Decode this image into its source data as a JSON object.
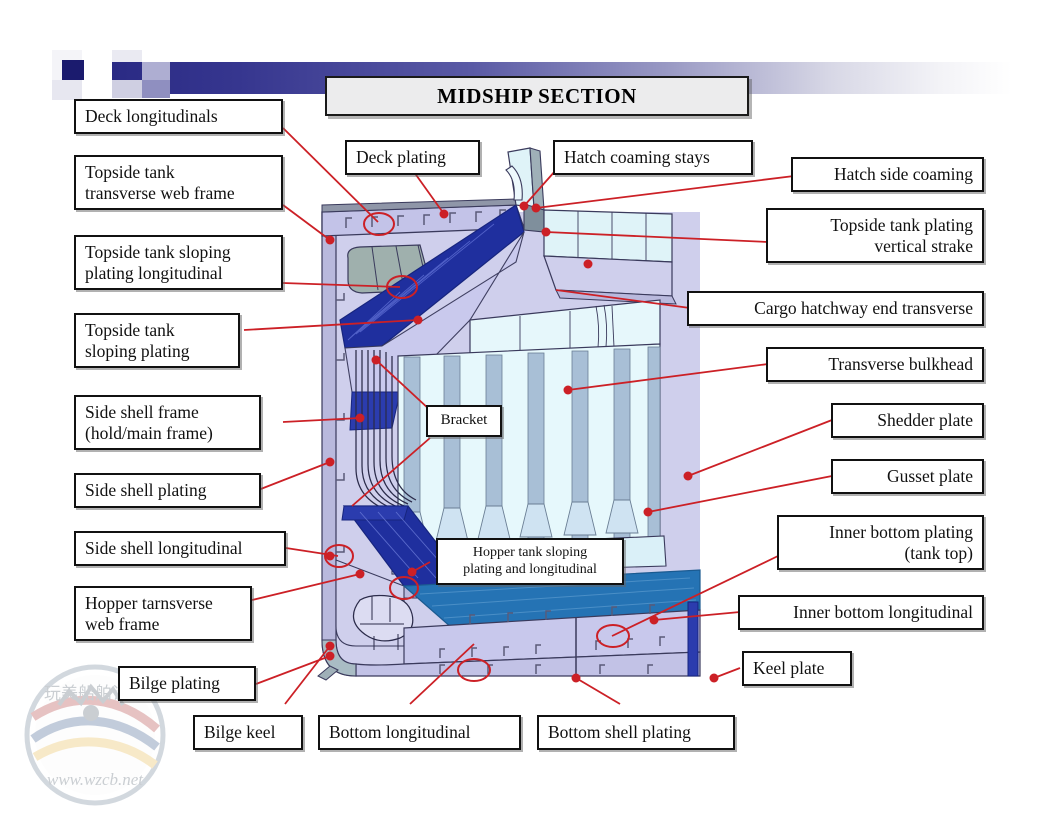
{
  "title": "MIDSHIP SECTION",
  "diagram_name": "ship-midship-section-drawing",
  "watermark": {
    "text_cn": "玩美船舶论坛",
    "url": "www.wzcb.net"
  },
  "colors": {
    "leader_line": "#cc2026",
    "dark_blue_plating": "#1f2f9e",
    "inner_bottom_blue": "#2573b4",
    "lavender_shell": "#c7c7ef",
    "pale_cyan_bulkhead": "#e2f6fb",
    "stiffener_blue_grey": "#a8bfd6",
    "outline": "#2b2b4a",
    "title_fill": "#ececed",
    "band_start": "#2a2a84"
  },
  "labels": {
    "left": [
      {
        "id": "deck-longitudinals",
        "text": "Deck longitudinals"
      },
      {
        "id": "topside-tank-transverse-web-frame",
        "line1": "Topside tank",
        "line2": "transverse web frame"
      },
      {
        "id": "topside-tank-sloping-plating-longitudinal",
        "line1": "Topside tank sloping",
        "line2": "plating longitudinal"
      },
      {
        "id": "topside-tank-sloping-plating",
        "line1": "Topside tank",
        "line2": "sloping plating"
      },
      {
        "id": "side-shell-frame",
        "line1": "Side shell frame",
        "line2": "(hold/main frame)"
      },
      {
        "id": "side-shell-plating",
        "text": "Side shell plating"
      },
      {
        "id": "side-shell-longitudinal",
        "text": "Side shell longitudinal"
      },
      {
        "id": "hopper-transverse-web-frame",
        "line1": "Hopper tarnsverse",
        "line2": "web frame"
      },
      {
        "id": "bilge-plating",
        "text": "Bilge plating"
      }
    ],
    "top": [
      {
        "id": "deck-plating",
        "text": "Deck plating"
      },
      {
        "id": "hatch-coaming-stays",
        "text": "Hatch coaming stays"
      }
    ],
    "right": [
      {
        "id": "hatch-side-coaming",
        "text": "Hatch side coaming"
      },
      {
        "id": "topside-tank-plating-vertical-strake",
        "line1": "Topside tank plating",
        "line2": "vertical strake"
      },
      {
        "id": "cargo-hatchway-end-transverse",
        "text": "Cargo hatchway end transverse"
      },
      {
        "id": "transverse-bulkhead",
        "text": "Transverse bulkhead"
      },
      {
        "id": "shedder-plate",
        "text": "Shedder plate"
      },
      {
        "id": "gusset-plate",
        "text": "Gusset plate"
      },
      {
        "id": "inner-bottom-plating",
        "line1": "Inner bottom plating",
        "line2": "(tank top)"
      },
      {
        "id": "inner-bottom-longitudinal",
        "text": "Inner bottom longitudinal"
      },
      {
        "id": "keel-plate",
        "text": "Keel plate"
      }
    ],
    "bottom": [
      {
        "id": "bilge-keel",
        "text": "Bilge keel"
      },
      {
        "id": "bottom-longitudinal",
        "text": "Bottom longitudinal"
      },
      {
        "id": "bottom-shell-plating",
        "text": "Bottom shell plating"
      }
    ],
    "inner": [
      {
        "id": "bracket",
        "text": "Bracket"
      },
      {
        "id": "hopper-tank-sloping-plating-and-longitudinal",
        "line1": "Hopper tank sloping",
        "line2": "plating and longitudinal"
      }
    ]
  }
}
